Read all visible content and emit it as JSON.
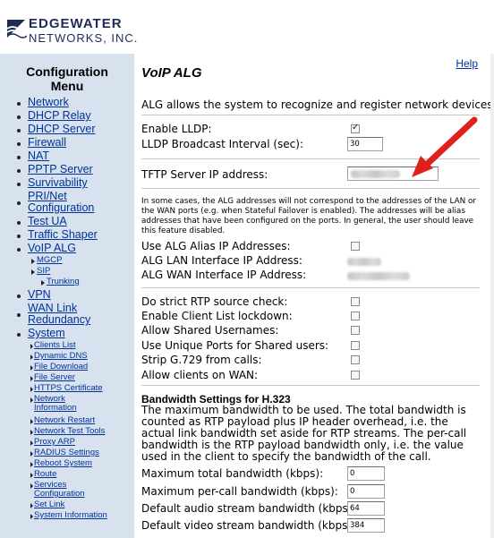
{
  "brand": {
    "line1": "EDGEWATER",
    "line2": "NETWORKS, INC."
  },
  "menu": {
    "title_line1": "Configuration",
    "title_line2": "Menu",
    "items": [
      {
        "label": "Network"
      },
      {
        "label": "DHCP Relay"
      },
      {
        "label": "DHCP Server"
      },
      {
        "label": "Firewall"
      },
      {
        "label": "NAT"
      },
      {
        "label": "PPTP Server"
      },
      {
        "label": "Survivability"
      },
      {
        "label_line1": "PRI/Net",
        "label_line2": "Configuration"
      },
      {
        "label": "Test UA"
      },
      {
        "label": "Traffic Shaper"
      },
      {
        "label": "VoIP ALG"
      }
    ],
    "voip_sub": [
      {
        "label": "MGCP"
      },
      {
        "label": "SIP"
      }
    ],
    "sip_sub": [
      {
        "label": "Trunking"
      }
    ],
    "after": [
      {
        "label": "VPN"
      },
      {
        "label_line1": "WAN Link",
        "label_line2": "Redundancy"
      },
      {
        "label": "System"
      }
    ],
    "system_sub": [
      {
        "label": "Clients List"
      },
      {
        "label": "Dynamic DNS"
      },
      {
        "label": "File Download"
      },
      {
        "label": "File Server"
      },
      {
        "label": "HTTPS Certificate"
      },
      {
        "label_line1": "Network",
        "label_line2": "Information"
      },
      {
        "label": "Network Restart"
      },
      {
        "label": "Network Test Tools"
      },
      {
        "label": "Proxy ARP"
      },
      {
        "label": "RADIUS Settings"
      },
      {
        "label": "Reboot System"
      },
      {
        "label": "Route"
      },
      {
        "label_line1": "Services",
        "label_line2": "Configuration"
      },
      {
        "label": "Set Link"
      },
      {
        "label": "System Information"
      }
    ]
  },
  "main": {
    "help_label": "Help",
    "title": "VoIP ALG",
    "intro": "ALG allows the system to recognize and register network devices.",
    "lldp": {
      "enable_label": "Enable LLDP:",
      "enable_checked": true,
      "interval_label": "LLDP Broadcast Interval (sec):",
      "interval_value": "30"
    },
    "tftp_label": "TFTP Server IP address:",
    "note": "In some cases, the ALG addresses will not correspond to the addresses of the LAN or the WAN ports (e.g. when Stateful Failover is enabled). The addresses will be alias addresses that have been configured on the ports. In general, the user should leave this feature disabled.",
    "alias": {
      "use_label": "Use ALG Alias IP Addresses:",
      "lan_label": "ALG LAN Interface IP Address:",
      "wan_label": "ALG WAN Interface IP Address:"
    },
    "options": [
      {
        "label": "Do strict RTP source check:"
      },
      {
        "label": "Enable Client List lockdown:"
      },
      {
        "label": "Allow Shared Usernames:"
      },
      {
        "label": "Use Unique Ports for Shared users:"
      },
      {
        "label": "Strip G.729 from calls:"
      },
      {
        "label": "Allow clients on WAN:"
      }
    ],
    "bandwidth": {
      "heading": "Bandwidth Settings for H.323",
      "description": "The maximum bandwidth to be used. The total bandwidth is counted as RTP payload plus IP header overhead, i.e. the actual link bandwidth set aside for RTP streams. The per-call bandwidth is the RTP payload bandwidth only, i.e. the value used in the client to specify the bandwidth of the call.",
      "fields": [
        {
          "label": "Maximum total bandwidth (kbps):",
          "value": "0"
        },
        {
          "label": "Maximum per-call bandwidth (kbps):",
          "value": "0"
        },
        {
          "label": "Default audio stream bandwidth (kbps):",
          "value": "64"
        },
        {
          "label": "Default video stream bandwidth (kbps):",
          "value": "384"
        }
      ]
    }
  },
  "colors": {
    "sidebar_bg": "#d8e1ee",
    "link": "#003399",
    "arrow": "#e0201b",
    "brand": "#1e2c55"
  }
}
